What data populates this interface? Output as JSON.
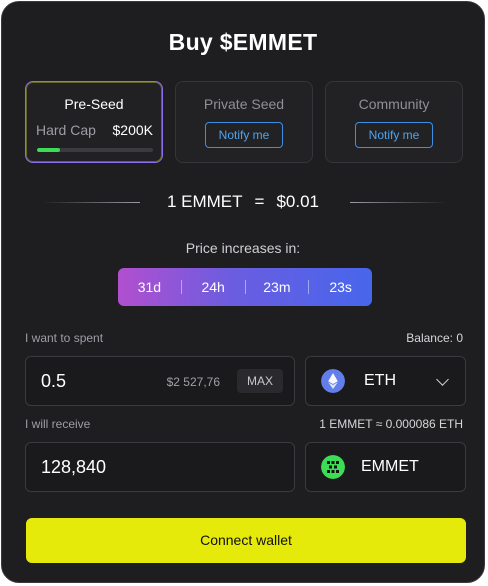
{
  "title": "Buy $EMMET",
  "tiers": [
    {
      "name": "Pre-Seed",
      "hard_cap_label": "Hard Cap",
      "hard_cap_value": "$200K",
      "progress": 0.2
    },
    {
      "name": "Private Seed",
      "button": "Notify me"
    },
    {
      "name": "Community",
      "button": "Notify me"
    }
  ],
  "rate": {
    "left": "1 EMMET",
    "eq": "=",
    "right": "$0.01"
  },
  "price_increase_label": "Price increases in:",
  "timer": [
    "31d",
    "24h",
    "23m",
    "23s"
  ],
  "spend": {
    "label": "I want to spent",
    "balance": "Balance: 0",
    "amount": "0.5",
    "usd": "$2 527,76",
    "max": "MAX",
    "token": "ETH"
  },
  "receive": {
    "label": "I will receive",
    "rate": "1 EMMET ≈ 0.000086 ETH",
    "amount": "128,840",
    "token": "EMMET"
  },
  "connect_label": "Connect wallet",
  "colors": {
    "accent": "#e6ea0b",
    "progress": "#3ddc56",
    "notify": "#4ea3f0",
    "eth": "#627eea",
    "emmet": "#3ddc56"
  }
}
